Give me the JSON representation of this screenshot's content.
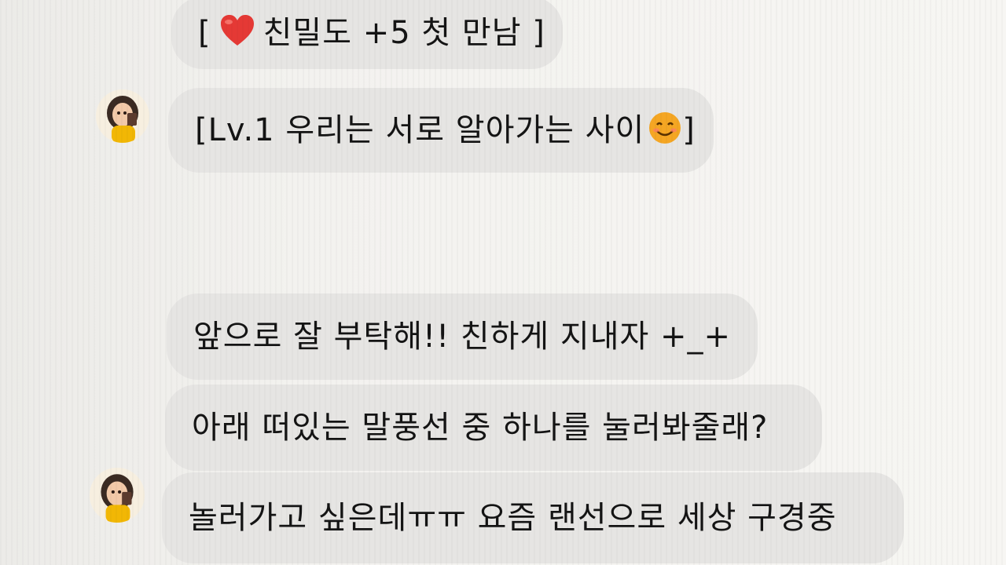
{
  "messages": [
    {
      "id": "msg-1",
      "prefix": "[",
      "text": "친밀도 +5 첫 만남 ]",
      "icon": "heart-icon",
      "color": "#e53935"
    },
    {
      "id": "msg-2",
      "text": "[Lv.1 우리는 서로 알아가는 사이",
      "suffix": "]",
      "icon": "smiling-face-emoji-icon"
    },
    {
      "id": "msg-3",
      "text": "앞으로 잘 부탁해!! 친하게 지내자 +_+"
    },
    {
      "id": "msg-4",
      "text": "아래 떠있는 말풍선 중 하나를 눌러봐줄래?"
    },
    {
      "id": "msg-5",
      "text": "놀러가고 싶은데ㅠㅠ 요즘 랜선으로 세상 구경중"
    }
  ],
  "avatars": [
    {
      "id": "avatar-1",
      "icon": "character-avatar-icon"
    },
    {
      "id": "avatar-2",
      "icon": "character-avatar-icon"
    }
  ],
  "colors": {
    "bubble": "#e6e5e3",
    "text": "#141414",
    "heart": "#e53935",
    "emoji": "#f5a623"
  }
}
